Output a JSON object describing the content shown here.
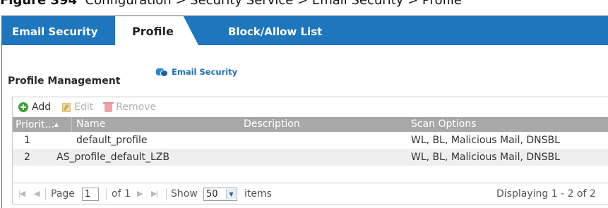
{
  "caption": {
    "label": "Figure 394",
    "text": "Configuration > Security Service > Email Security > Profile"
  },
  "tabs": [
    {
      "label": "Email Security",
      "active": false
    },
    {
      "label": "Profile",
      "active": true
    },
    {
      "label": "Block/Allow List",
      "active": false
    }
  ],
  "section": {
    "title": "Profile Management",
    "link_label": "Email Security",
    "link_icon": "email-security-icon"
  },
  "toolbar": {
    "add_label": "Add",
    "edit_label": "Edit",
    "remove_label": "Remove"
  },
  "table": {
    "columns": [
      "Priorit...",
      "Name",
      "Description",
      "Scan Options"
    ],
    "sort_indicator": "▲",
    "rows": [
      {
        "priority": "1",
        "name": "default_profile",
        "description": "",
        "scan_options": "WL, BL, Malicious Mail, DNSBL"
      },
      {
        "priority": "2",
        "name": "AS_profile_default_LZB",
        "description": "",
        "scan_options": "WL, BL, Malicious Mail, DNSBL"
      }
    ]
  },
  "pager": {
    "page_label": "Page",
    "page_value": "1",
    "of_label": "of 1",
    "show_label": "Show",
    "show_value": "50",
    "items_label": "items",
    "display_text": "Displaying 1 - 2 of 2"
  },
  "colors": {
    "tabbar": "#1e76bd",
    "header": "#a8a8a8",
    "add_green": "#3ea13a"
  }
}
